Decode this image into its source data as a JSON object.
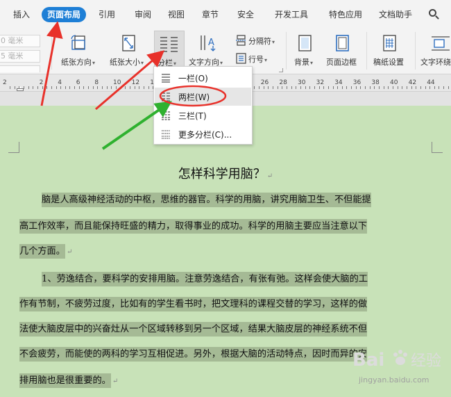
{
  "tabs": [
    {
      "label": "插入"
    },
    {
      "label": "页面布局"
    },
    {
      "label": "引用"
    },
    {
      "label": "审阅"
    },
    {
      "label": "视图"
    },
    {
      "label": "章节"
    },
    {
      "label": "安全"
    },
    {
      "label": "开发工具"
    },
    {
      "label": "特色应用"
    },
    {
      "label": "文档助手"
    }
  ],
  "search_label": "Q",
  "ribbon": {
    "margin_values": [
      "0 毫米",
      "5 毫米"
    ],
    "paper_direction": "纸张方向",
    "paper_size": "纸张大小",
    "columns": "分栏",
    "text_direction": "文字方向",
    "separator": "分隔符",
    "line_number": "行号",
    "background": "背景",
    "page_border": "页面边框",
    "manuscript_settings": "稿纸设置",
    "text_wrap": "文字环绕"
  },
  "ruler": {
    "numbers": [
      "2",
      "2",
      "4",
      "6",
      "8",
      "10",
      "12",
      "14",
      "16",
      "18",
      "20",
      "22",
      "24",
      "26",
      "28",
      "30",
      "32",
      "34",
      "36",
      "38",
      "40",
      "42",
      "44"
    ]
  },
  "dropdown": {
    "items": [
      {
        "label": "一栏(O)"
      },
      {
        "label": "两栏(W)"
      },
      {
        "label": "三栏(T)"
      },
      {
        "label": "更多分栏(C)..."
      }
    ]
  },
  "document": {
    "title": "怎样科学用脑？",
    "lines": [
      "脑是人高级神经活动的中枢，思维的器官。科学的用脑，讲究用脑卫生、不但能提",
      "高工作效率，而且能保持旺盛的精力，取得事业的成功。科学的用脑主要应当注意以下",
      "几个方面。",
      "1、劳逸结合，要科学的安排用脑。注意劳逸结合，有张有弛。这样会使大脑的工",
      "作有节制，不疲劳过度，比如有的学生看书时，把文理科的课程交替的学习，这样的做",
      "法使大脑皮层中的兴奋灶从一个区域转移到另一个区域，结果大脑皮层的神经系统不但",
      "不会疲劳，而能使的两科的学习互相促进。另外，根据大脑的活动特点，因时而异的安",
      "排用脑也是很重要的。"
    ]
  },
  "watermark": {
    "brand": "Bai",
    "brand2": "经验",
    "url": "jingyan.baidu.com"
  },
  "colors": {
    "active_tab": "#1e7fd6",
    "document_bg": "#c8e2b8",
    "highlight": "#a5ba95",
    "arrow_red": "#e8312a",
    "arrow_green": "#2fb12f",
    "ellipse_red": "#e8312a"
  }
}
